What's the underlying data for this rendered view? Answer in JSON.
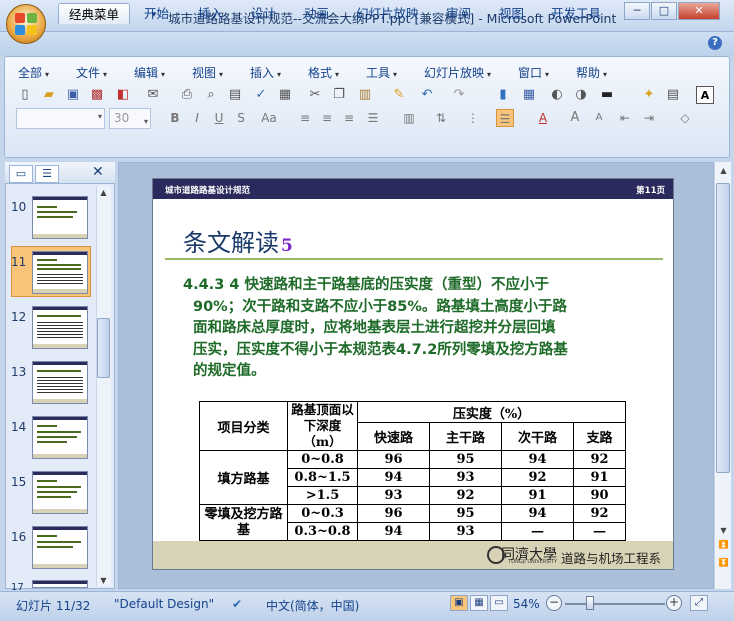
{
  "window": {
    "title": "城市道路路基设计规范--交流会大纲PPT.ppt [兼容模式] - Microsoft PowerPoint",
    "minimize_glyph": "─",
    "maximize_glyph": "□",
    "close_glyph": "✕"
  },
  "quick_access": {
    "save_icon": "save-icon",
    "undo_icon": "undo-icon",
    "redo_icon": "redo-icon",
    "customize_icon": "chevron-down-icon"
  },
  "ribbon_tabs": [
    "经典菜单",
    "开始",
    "插入",
    "设计",
    "动画",
    "幻灯片放映",
    "审阅",
    "视图",
    "开发工具"
  ],
  "active_tab": "经典菜单",
  "classic_menu": [
    "全部",
    "文件",
    "编辑",
    "视图",
    "插入",
    "格式",
    "工具",
    "幻灯片放映",
    "窗口",
    "帮助"
  ],
  "format_bar": {
    "font_name": "",
    "font_size": "30",
    "bold": "B",
    "italic": "I",
    "underline": "U",
    "shadow": "S",
    "change_case": "Aa",
    "grow_font": "A",
    "shrink_font": "A"
  },
  "toolbar_right_letter": "A",
  "slides_pane": {
    "tab_slides_glyph": "▭",
    "tab_outline_glyph": "☰",
    "close_glyph": "✕",
    "slide_numbers": [
      "10",
      "11",
      "12",
      "13",
      "14",
      "15",
      "16",
      "17"
    ],
    "selected": "11"
  },
  "slide": {
    "header_left": "城市道路路基设计规范",
    "header_right": "第11页",
    "title": "条文解读",
    "title_number": "5",
    "body_lines": [
      "4.4.3  4 快速路和主干路基底的压实度（重型）不应小于",
      "90%；次干路和支路不应小于85%。路基填土高度小于路",
      "面和路床总厚度时，应将地基表层土进行超挖并分层回填",
      "压实，压实度不得小于本规范表4.7.2所列零填及挖方路基",
      "的规定值。"
    ],
    "table": {
      "col_category": "项目分类",
      "col_depth": "路基顶面以下深度（m）",
      "col_compaction": "压实度（%）",
      "sub_headers": [
        "快速路",
        "主干路",
        "次干路",
        "支路"
      ],
      "groups": [
        {
          "name": "填方路基",
          "rows": [
            {
              "depth": "0~0.8",
              "values": [
                "96",
                "95",
                "94",
                "92"
              ]
            },
            {
              "depth": "0.8~1.5",
              "values": [
                "94",
                "93",
                "92",
                "91"
              ]
            },
            {
              "depth": ">1.5",
              "values": [
                "93",
                "92",
                "91",
                "90"
              ]
            }
          ]
        },
        {
          "name": "零填及挖方路基",
          "rows": [
            {
              "depth": "0~0.3",
              "values": [
                "96",
                "95",
                "94",
                "92"
              ]
            },
            {
              "depth": "0.3~0.8",
              "values": [
                "94",
                "93",
                "—",
                "—"
              ]
            }
          ]
        }
      ]
    },
    "footer_university": "同濟大學",
    "footer_university_en": "TONGJI UNIVERSITY",
    "footer_department": "道路与机场工程系"
  },
  "status_bar": {
    "slide_info": "幻灯片 11/32",
    "design": "\"Default Design\"",
    "language": "中文(简体，中国)",
    "zoom": "54%",
    "zoom_out": "−",
    "zoom_in": "+"
  },
  "colors": {
    "accent_title": "#1a3a6a",
    "body_green": "#1e6a28",
    "title_number": "#7a28c8",
    "slide_header_bg": "#2a2a5c",
    "selected_thumb": "#f7c47a"
  }
}
